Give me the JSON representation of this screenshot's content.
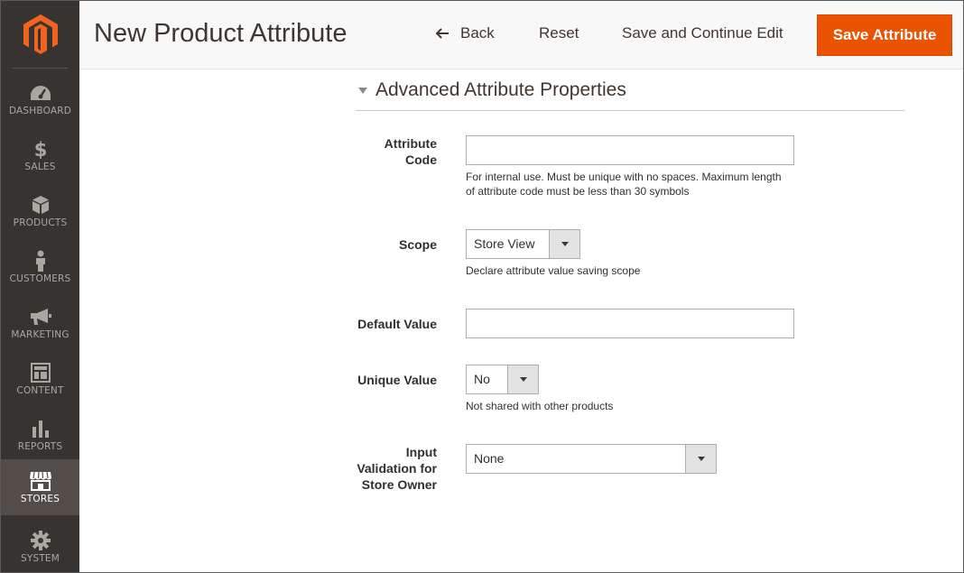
{
  "sidebar": {
    "logo": "magento-logo",
    "items": [
      {
        "label": "DASHBOARD",
        "icon": "dashboard-icon"
      },
      {
        "label": "SALES",
        "icon": "dollar-icon"
      },
      {
        "label": "PRODUCTS",
        "icon": "cube-icon"
      },
      {
        "label": "CUSTOMERS",
        "icon": "person-icon"
      },
      {
        "label": "MARKETING",
        "icon": "megaphone-icon"
      },
      {
        "label": "CONTENT",
        "icon": "layout-icon"
      },
      {
        "label": "REPORTS",
        "icon": "bar-chart-icon"
      },
      {
        "label": "STORES",
        "icon": "storefront-icon",
        "active": true
      },
      {
        "label": "SYSTEM",
        "icon": "gear-icon"
      }
    ]
  },
  "header": {
    "title": "New Product Attribute",
    "back_label": "Back",
    "reset_label": "Reset",
    "save_continue_label": "Save and Continue Edit",
    "save_label": "Save Attribute"
  },
  "section": {
    "title": "Advanced Attribute Properties",
    "attribute_code": {
      "label": "Attribute Code",
      "value": "",
      "note": "For internal use. Must be unique with no spaces. Maximum length of attribute code must be less than 30 symbols"
    },
    "scope": {
      "label": "Scope",
      "value": "Store View",
      "note": "Declare attribute value saving scope"
    },
    "default_value": {
      "label": "Default Value",
      "value": ""
    },
    "unique_value": {
      "label": "Unique Value",
      "value": "No",
      "note": "Not shared with other products"
    },
    "input_validation": {
      "label": "Input Validation for Store Owner",
      "value": "None"
    }
  },
  "colors": {
    "accent": "#eb5202",
    "sidebar_bg": "#373330",
    "sidebar_active": "#524d49"
  }
}
